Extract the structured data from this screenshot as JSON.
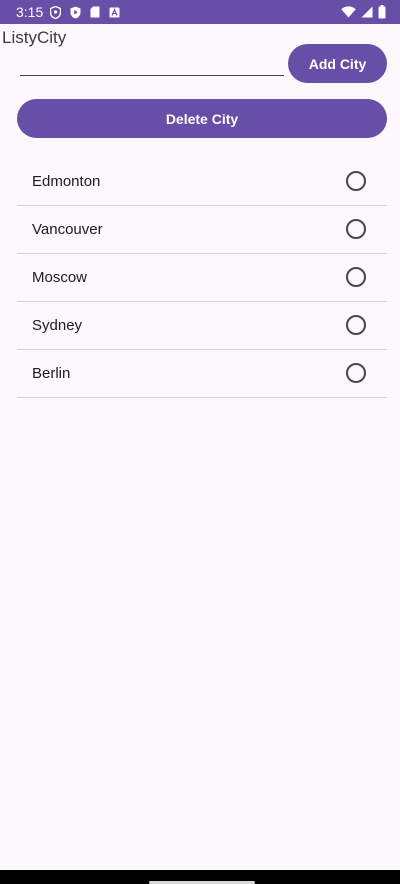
{
  "status_bar": {
    "time": "3:15",
    "left_icons": [
      "shield-icon",
      "play-protect-icon",
      "sd-card-icon",
      "autofill-icon"
    ],
    "right_icons": [
      "wifi-icon",
      "signal-icon",
      "battery-icon"
    ],
    "background": "#674ea7"
  },
  "app": {
    "title": "ListyCity"
  },
  "input": {
    "value": "",
    "placeholder": ""
  },
  "buttons": {
    "add_label": "Add City",
    "delete_label": "Delete City",
    "color": "#674ea7"
  },
  "cities": [
    {
      "name": "Edmonton",
      "selected": false
    },
    {
      "name": "Vancouver",
      "selected": false
    },
    {
      "name": "Moscow",
      "selected": false
    },
    {
      "name": "Sydney",
      "selected": false
    },
    {
      "name": "Berlin",
      "selected": false
    }
  ]
}
